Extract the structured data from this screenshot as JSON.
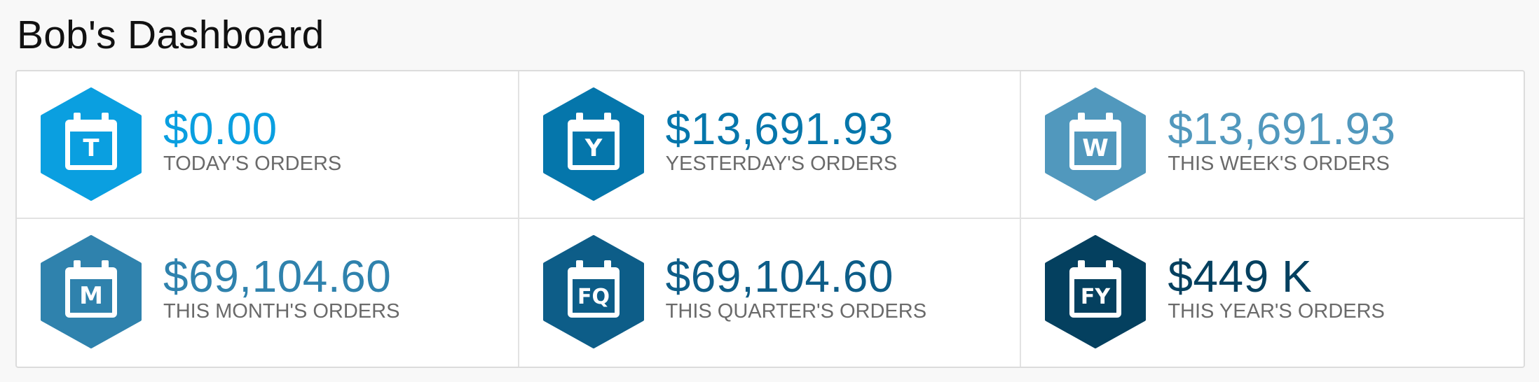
{
  "page": {
    "title": "Bob's Dashboard"
  },
  "tiles": [
    {
      "letter": "T",
      "value": "$0.00",
      "label": "TODAY'S ORDERS",
      "color": "#0a9fe0",
      "icon": "calendar-today-icon"
    },
    {
      "letter": "Y",
      "value": "$13,691.93",
      "label": "YESTERDAY'S ORDERS",
      "color": "#0576ab",
      "icon": "calendar-yesterday-icon"
    },
    {
      "letter": "W",
      "value": "$13,691.93",
      "label": "THIS WEEK'S ORDERS",
      "color": "#5198bd",
      "icon": "calendar-week-icon"
    },
    {
      "letter": "M",
      "value": "$69,104.60",
      "label": "THIS MONTH'S ORDERS",
      "color": "#2f82ad",
      "icon": "calendar-month-icon"
    },
    {
      "letter": "FQ",
      "value": "$69,104.60",
      "label": "THIS QUARTER'S ORDERS",
      "color": "#0d5d88",
      "icon": "calendar-quarter-icon"
    },
    {
      "letter": "FY",
      "value": "$449 K",
      "label": "THIS YEAR'S ORDERS",
      "color": "#04405f",
      "icon": "calendar-year-icon"
    }
  ]
}
